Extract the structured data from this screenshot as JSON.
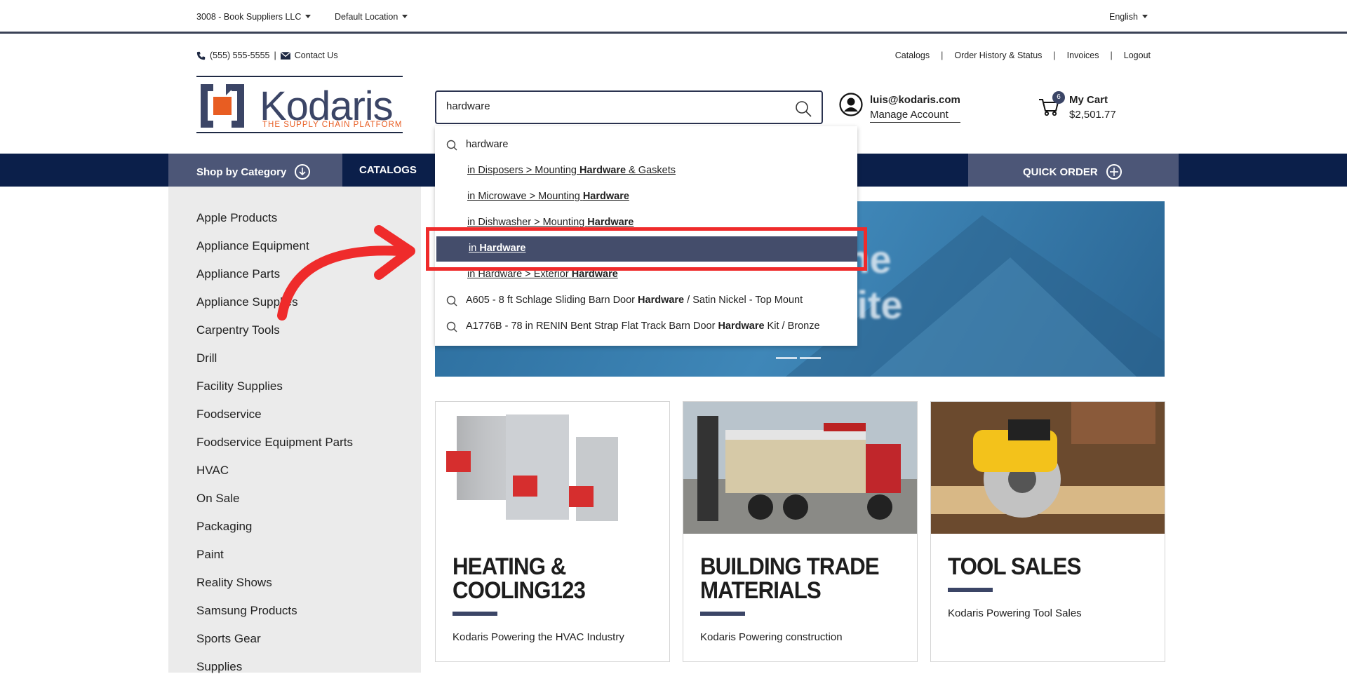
{
  "topbar": {
    "account_selector": "3008 - Book Suppliers LLC",
    "location_selector": "Default Location",
    "language_selector": "English"
  },
  "header": {
    "phone": "(555) 555-5555",
    "contact_link": "Contact Us",
    "links": [
      "Catalogs",
      "Order History & Status",
      "Invoices",
      "Logout"
    ],
    "logo_word": "Kodaris",
    "logo_tagline": "THE SUPPLY CHAIN PLATFORM",
    "search_value": "hardware",
    "account_email": "luis@kodaris.com",
    "account_manage": "Manage Account",
    "cart_count": "6",
    "cart_label": "My Cart",
    "cart_total": "$2,501.77"
  },
  "nav": {
    "shop_by_category": "Shop by Category",
    "catalogs": "CATALOGS",
    "quick_order": "QUICK ORDER"
  },
  "sidebar": {
    "categories": [
      "Apple Products",
      "Appliance Equipment",
      "Appliance Parts",
      "Appliance Supplies",
      "Carpentry Tools",
      "Drill",
      "Facility Supplies",
      "Foodservice",
      "Foodservice Equipment Parts",
      "HVAC",
      "On Sale",
      "Packaging",
      "Paint",
      "Reality Shows",
      "Samsung Products",
      "Sports Gear",
      "Supplies"
    ]
  },
  "banner": {
    "line1": "e the",
    "line2": "no Site"
  },
  "dropdown": {
    "query": "hardware",
    "suggestions": [
      {
        "pre": "in Disposers > Mounting ",
        "bold": "Hardware",
        "post": " & Gaskets"
      },
      {
        "pre": "in Microwave > Mounting ",
        "bold": "Hardware",
        "post": ""
      },
      {
        "pre": "in Dishwasher > Mounting ",
        "bold": "Hardware",
        "post": ""
      },
      {
        "pre": "in ",
        "bold": "Hardware",
        "post": ""
      },
      {
        "pre": "in Hardware > Exterior ",
        "bold": "Hardware",
        "post": ""
      }
    ],
    "products": [
      {
        "pre": "A605 - 8 ft Schlage Sliding Barn Door ",
        "bold": "Hardware",
        "post": " / Satin Nickel - Top Mount"
      },
      {
        "pre": "A1776B - 78 in RENIN Bent Strap Flat Track Barn Door ",
        "bold": "Hardware",
        "post": " Kit / Bronze"
      }
    ]
  },
  "cards": [
    {
      "title_line1": "HEATING &",
      "title_line2": "COOLING123",
      "desc": "Kodaris Powering the HVAC Industry"
    },
    {
      "title_line1": "BUILDING TRADE",
      "title_line2": "MATERIALS",
      "desc": "Kodaris Powering construction"
    },
    {
      "title_line1": "TOOL SALES",
      "title_line2": "",
      "desc": "Kodaris Powering Tool Sales"
    }
  ],
  "colors": {
    "navy": "#0b1f4a",
    "slate": "#4c5677",
    "accent_orange": "#e85d22",
    "annotation_red": "#ef2b2b"
  }
}
